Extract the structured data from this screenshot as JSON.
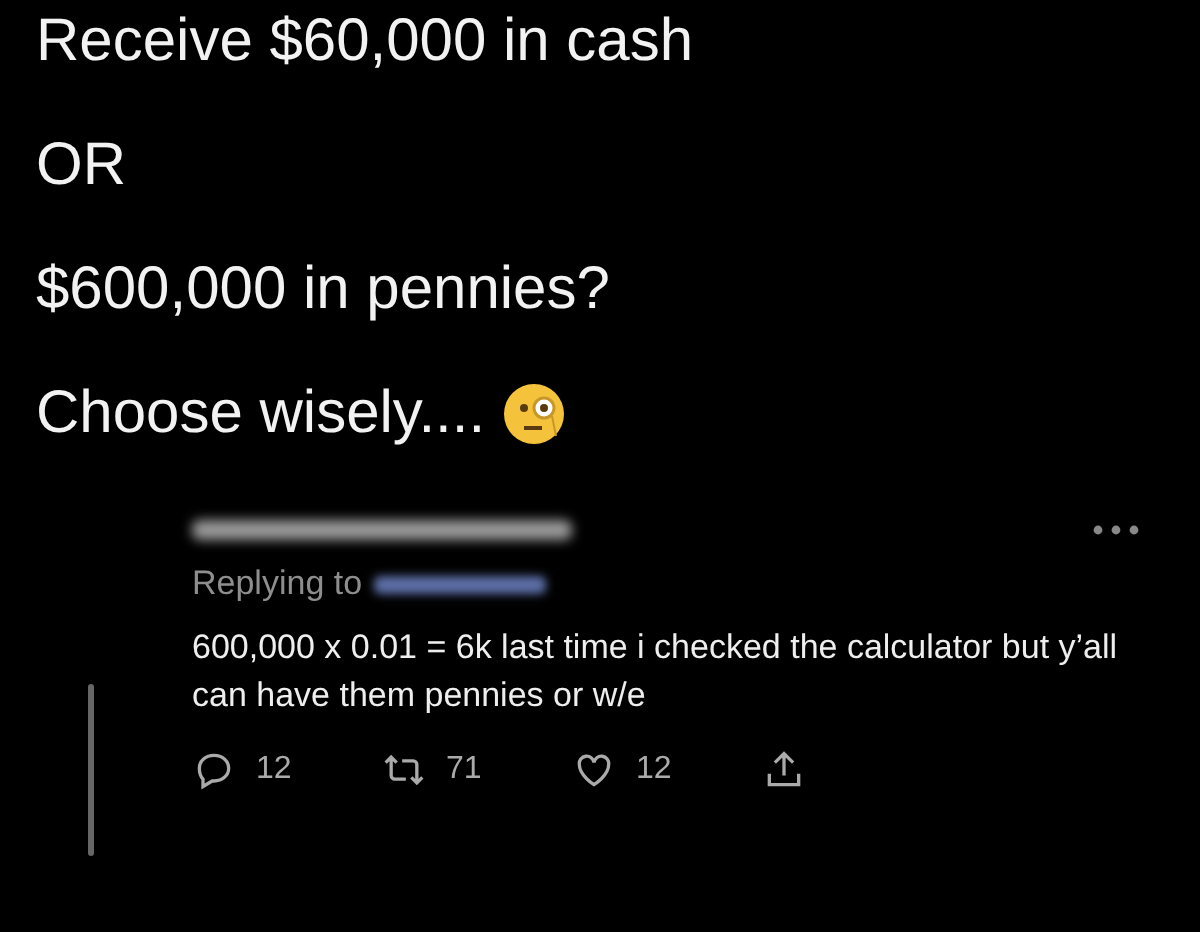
{
  "tweet": {
    "lines": [
      "Receive $60,000 in cash",
      "OR",
      "$600,000 in pennies?",
      "Choose wisely...."
    ]
  },
  "reply": {
    "replying_label": "Replying to",
    "text": "600,000 x 0.01 = 6k  last time i checked the calculator but y’all can have them pennies or w/e",
    "actions": [
      {
        "kind": "reply",
        "count": "12"
      },
      {
        "kind": "retweet",
        "count": "71"
      },
      {
        "kind": "like",
        "count": "12"
      },
      {
        "kind": "share"
      }
    ]
  }
}
